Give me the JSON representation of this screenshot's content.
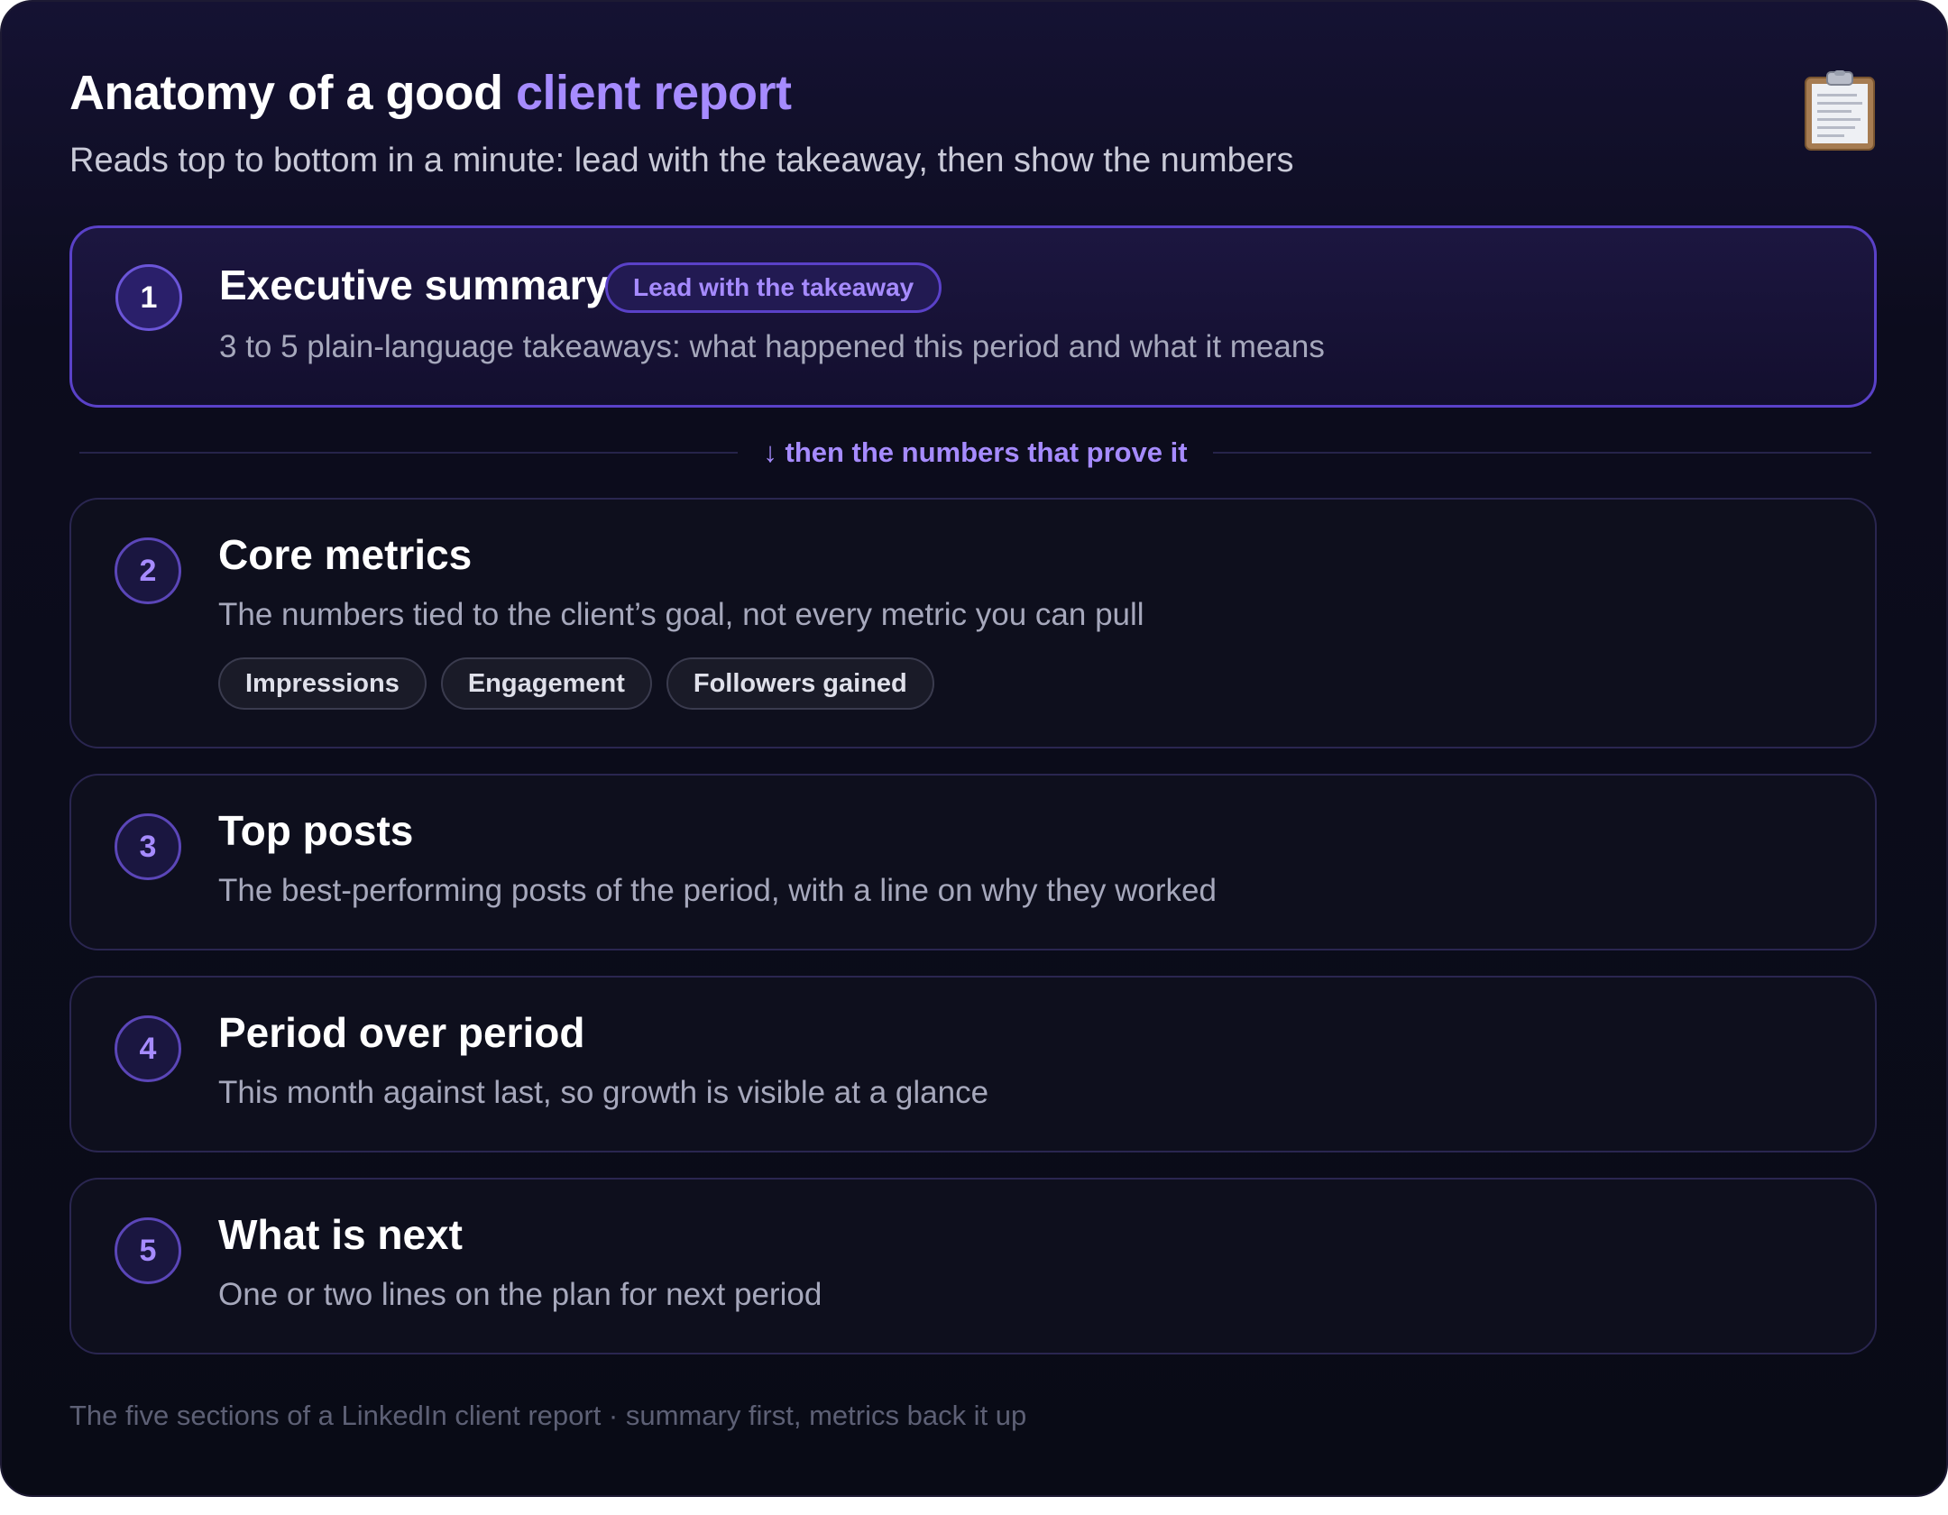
{
  "header": {
    "title_prefix": "Anatomy of a good ",
    "title_accent": "client report",
    "subtitle": "Reads top to bottom in a minute: lead with the takeaway, then show the numbers",
    "icon": "clipboard-icon"
  },
  "sections": [
    {
      "number": "1",
      "title": "Executive summary",
      "tag": "Lead with the takeaway",
      "description": "3 to 5 plain-language takeaways: what happened this period and what it means"
    },
    {
      "number": "2",
      "title": "Core metrics",
      "description": "The numbers tied to the client’s goal, not every metric you can pull",
      "chips": [
        "Impressions",
        "Engagement",
        "Followers gained"
      ]
    },
    {
      "number": "3",
      "title": "Top posts",
      "description": "The best-performing posts of the period, with a line on why they worked"
    },
    {
      "number": "4",
      "title": "Period over period",
      "description": "This month against last, so growth is visible at a glance"
    },
    {
      "number": "5",
      "title": "What is next",
      "description": "One or two lines on the plan for next period"
    }
  ],
  "divider": {
    "label": "↓ then the numbers that prove it"
  },
  "footer": {
    "caption": "The five sections of a LinkedIn client report · summary first, metrics back it up"
  },
  "colors": {
    "background": "#0a0b17",
    "accent": "#a68bff",
    "highlight_border": "#5a41c8",
    "section_border": "#2a2650",
    "text_primary": "#ffffff",
    "text_secondary": "#a6a8bc",
    "text_muted": "#5d6075"
  }
}
